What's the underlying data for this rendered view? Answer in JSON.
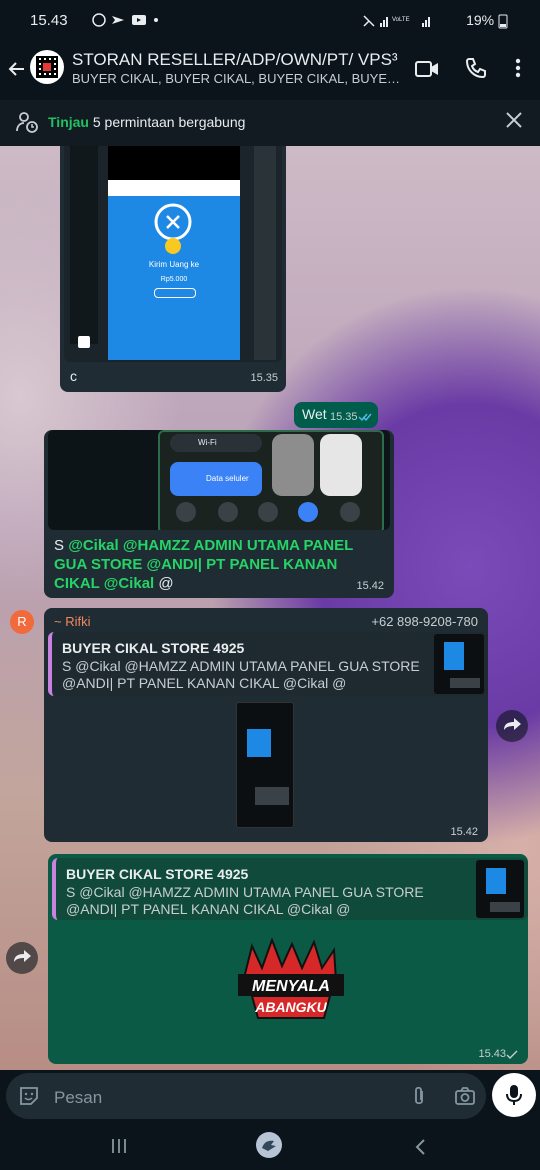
{
  "status_bar": {
    "time": "15.43",
    "battery": "19%"
  },
  "header": {
    "title": "STORAN RESELLER/ADP/OWN/PT/ VPS³",
    "subtitle": "BUYER CIKAL, BUYER CIKAL, BUYER CIKAL, BUYER CIKAL, BUYER CIKAL"
  },
  "join_banner": {
    "action": "Tinjau",
    "text": "5 permintaan bergabung"
  },
  "messages": {
    "m1": {
      "transfer_title": "Kirim Uang ke",
      "transfer_amount": "Rp5.000",
      "caption": "c",
      "time": "15.35"
    },
    "m2": {
      "text": "Wet",
      "time": "15.35"
    },
    "m3": {
      "wifi": "Wi-Fi",
      "data": "Data seluler",
      "caption_s": "S",
      "caption_m1": "@Cikal @HAMZZ ADMIN UTAMA PANEL GUA STORE @ANDI| PT PANEL KANAN CIKAL @Cikal",
      "caption_end": "@",
      "time": "15.42"
    },
    "m4": {
      "avatar_letter": "R",
      "sender": "~ Rifki",
      "phone": "+62 898-9208-780",
      "quote_title": "BUYER CIKAL STORE 4925",
      "quote_body": "S @Cikal @HAMZZ ADMIN UTAMA PANEL GUA STORE @ANDI| PT PANEL KANAN CIKAL @Cikal @",
      "time": "15.42"
    },
    "m5": {
      "quote_title": "BUYER CIKAL STORE 4925",
      "quote_body": "S @Cikal @HAMZZ ADMIN UTAMA PANEL GUA STORE @ANDI| PT PANEL KANAN CIKAL @Cikal @",
      "sticker_line1": "MENYALA",
      "sticker_line2": "ABANGKU",
      "time": "15.43"
    }
  },
  "input": {
    "placeholder": "Pesan"
  },
  "colors": {
    "accent_green": "#25d366",
    "bubble_in": "#1f2c33",
    "bubble_out": "#005c4b"
  }
}
